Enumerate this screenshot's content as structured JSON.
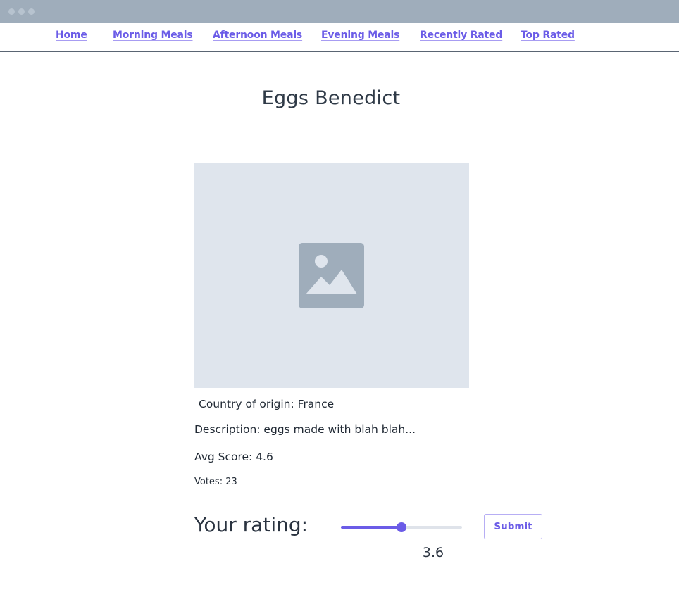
{
  "nav": {
    "items": [
      {
        "label": "Home"
      },
      {
        "label": "Morning Meals"
      },
      {
        "label": "Afternoon Meals"
      },
      {
        "label": "Evening Meals"
      },
      {
        "label": "Recently Rated"
      },
      {
        "label": "Top Rated"
      }
    ]
  },
  "meal": {
    "title": "Eggs Benedict",
    "image_icon": "image-placeholder-icon",
    "country": "Country of origin: France",
    "description": "Description: eggs made with blah blah...",
    "avg_score": "Avg Score: 4.6",
    "votes": "Votes: 23"
  },
  "rating": {
    "label": "Your rating:",
    "slider_fraction": 0.5,
    "value": "3.6",
    "submit_label": "Submit"
  },
  "colors": {
    "accent": "#6b5ce7",
    "titlebar": "#9fadbb",
    "image_bg": "#dfe5ed",
    "icon": "#9fadbb"
  }
}
